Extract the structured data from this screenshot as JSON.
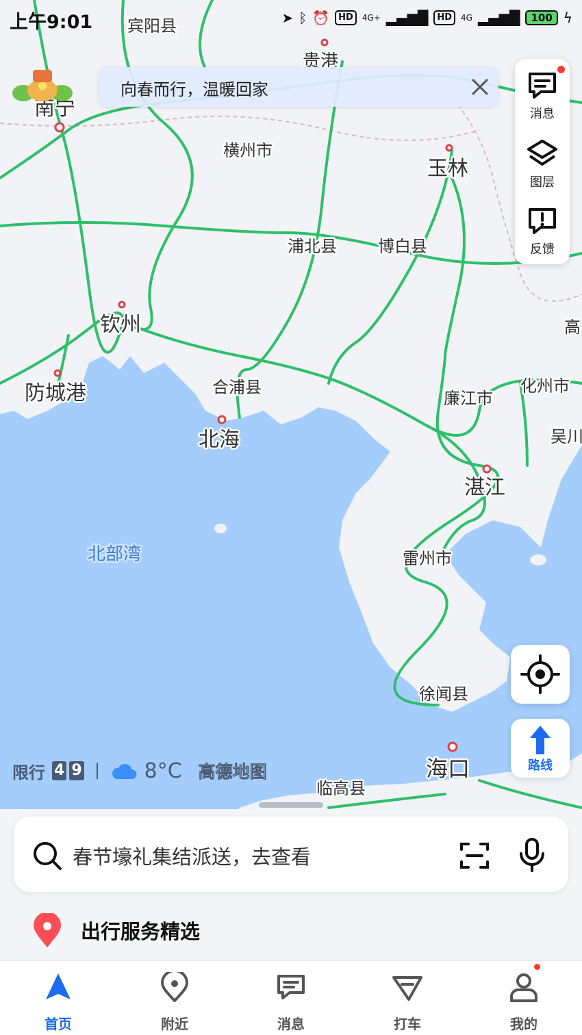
{
  "status_bar": {
    "time": "上午9:01",
    "network_1": "4G+",
    "network_2": "4G",
    "battery": "100"
  },
  "banner": {
    "text": "向春而行，温暖回家"
  },
  "side_panel": {
    "messages": "消息",
    "layers": "图层",
    "feedback": "反馈"
  },
  "map": {
    "sea_color": "#a4cdfb",
    "land_color": "#f1f3f6",
    "road_color": "#2fbf6a",
    "places": {
      "binyang": "宾阳县",
      "guigang": "贵港",
      "nanning": "南宁",
      "hengzhou": "横州市",
      "yulin": "玉林",
      "pubei": "浦北县",
      "bobai": "博白县",
      "qinzhou": "钦州",
      "fangchenggang": "防城港",
      "hepu": "合浦县",
      "beihai": "北海",
      "lianjiang": "廉江市",
      "huazhou": "化州市",
      "wuchuan": "吴川",
      "gao": "高",
      "zhanjiang": "湛江",
      "beibuwan": "北部湾",
      "leizhou": "雷州市",
      "xuwen": "徐闻县",
      "haikou": "海口",
      "lingao": "临高县"
    }
  },
  "info_bar": {
    "restriction_label": "限行",
    "plates": [
      "4",
      "9"
    ],
    "temperature": "8°C",
    "brand": "高德地图"
  },
  "route_button": {
    "label": "路线"
  },
  "search": {
    "placeholder": "春节壕礼集结派送，去查看"
  },
  "service": {
    "title": "出行服务精选"
  },
  "tabs": [
    {
      "label": "首页",
      "icon": "navigation-arrow-icon",
      "active": true
    },
    {
      "label": "附近",
      "icon": "location-pin-icon",
      "active": false
    },
    {
      "label": "消息",
      "icon": "message-icon",
      "active": false
    },
    {
      "label": "打车",
      "icon": "taxi-icon",
      "active": false
    },
    {
      "label": "我的",
      "icon": "person-icon",
      "active": false
    }
  ],
  "colors": {
    "accent": "#1c6cf2",
    "badge": "#ff3b30"
  }
}
